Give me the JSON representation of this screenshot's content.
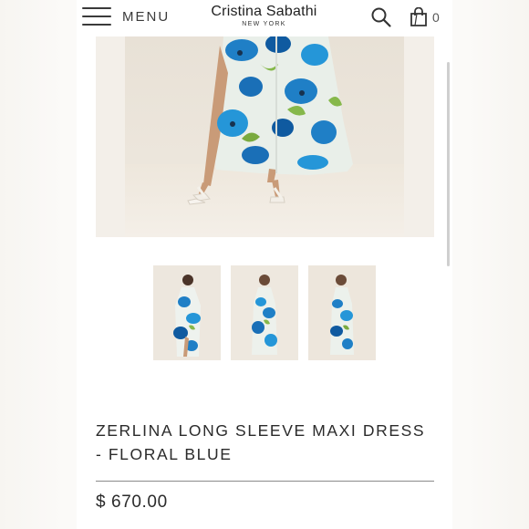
{
  "header": {
    "menu_label": "MENU",
    "brand_name": "Cristina Sabathi",
    "brand_sub": "NEW YORK",
    "cart_count": "0"
  },
  "gallery": {
    "main_image": "product-photo-model-legs-sandals",
    "thumbnails": [
      "thumbnail-front-view",
      "thumbnail-side-view",
      "thumbnail-alternate-view"
    ]
  },
  "product": {
    "title": "ZERLINA LONG SLEEVE MAXI DRESS - FLORAL BLUE",
    "price": "$ 670.00"
  },
  "colors": {
    "background": "#ffffff",
    "text": "#2b2b2b",
    "divider": "#8a8a8a",
    "dress_blue": "#1f7fc6",
    "dress_green": "#86b84b",
    "photo_backdrop": "#ece6dd"
  },
  "icons": {
    "menu": "hamburger-icon",
    "search": "search-icon",
    "cart": "shopping-bag-icon"
  }
}
